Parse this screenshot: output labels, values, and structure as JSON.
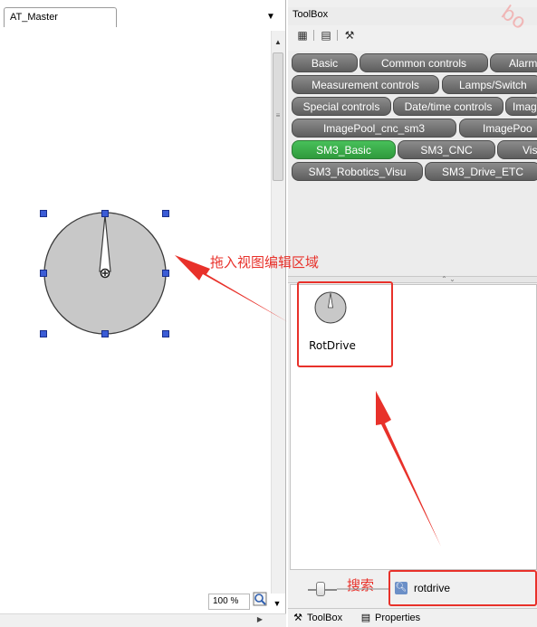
{
  "left_editor": {
    "doc_tab_label": "AT_Master",
    "zoom_value": "100 %"
  },
  "annotations": {
    "drag_hint": "拖入视图编辑区域",
    "search_hint": "搜索",
    "color": "#e8312a"
  },
  "toolbox": {
    "title": "ToolBox",
    "categories": [
      {
        "label": "Basic"
      },
      {
        "label": "Common controls"
      },
      {
        "label": "Alarm"
      },
      {
        "label": "Measurement controls"
      },
      {
        "label": "Lamps/Switch"
      },
      {
        "label": "Special controls"
      },
      {
        "label": "Date/time controls"
      },
      {
        "label": "Imag"
      },
      {
        "label": "ImagePool_cnc_sm3"
      },
      {
        "label": "ImagePoo"
      },
      {
        "label": "SM3_Basic"
      },
      {
        "label": "SM3_CNC"
      },
      {
        "label": "Vis"
      },
      {
        "label": "SM3_Robotics_Visu"
      },
      {
        "label": "SM3_Drive_ETC"
      }
    ],
    "active_category": "SM3_Basic",
    "active_color": "#3aaa4a",
    "items": [
      {
        "label": "RotDrive",
        "icon": "rotdrive-gauge-icon"
      }
    ],
    "search": {
      "value": "rotdrive",
      "icon": "search-icon"
    },
    "bottom_tabs": [
      {
        "label": "ToolBox",
        "icon": "hammer-icon"
      },
      {
        "label": "Properties",
        "icon": "properties-icon"
      }
    ]
  }
}
